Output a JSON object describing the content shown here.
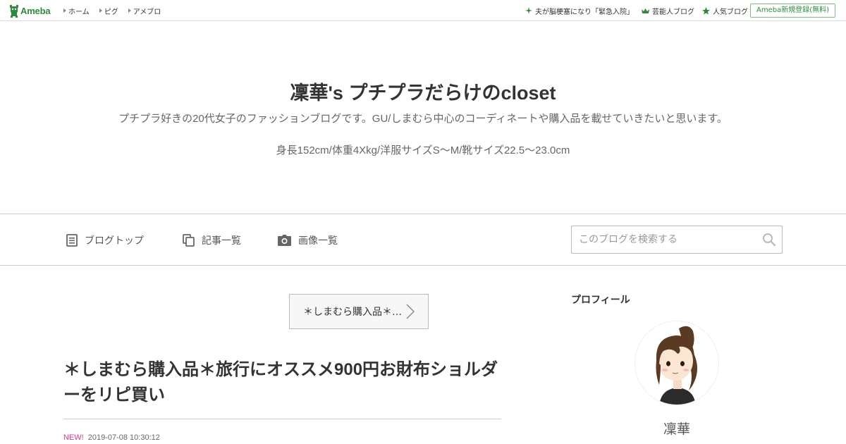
{
  "topbar": {
    "logo_text": "Ameba",
    "nav": [
      {
        "label": "ホーム"
      },
      {
        "label": "ピグ"
      },
      {
        "label": "アメブロ"
      }
    ],
    "links": [
      {
        "label": "夫が脳梗塞になり「緊急入院」",
        "icon": "sparkle-icon"
      },
      {
        "label": "芸能人ブログ",
        "icon": "crown-icon"
      },
      {
        "label": "人気ブログ",
        "icon": "star-icon"
      }
    ],
    "register_label": "Ameba新規登録(無料)"
  },
  "header": {
    "title": "凜華's プチプラだらけのcloset",
    "description": "プチプラ好きの20代女子のファッションブログです。GU/しまむら中心のコーディネートや購入品を載せていきたいと思います。",
    "description2": "身長152cm/体重4Xkg/洋服サイズS〜M/靴サイズ22.5〜23.0cm"
  },
  "navbar": {
    "items": [
      {
        "label": "ブログトップ",
        "icon": "document-icon"
      },
      {
        "label": "記事一覧",
        "icon": "copy-icon"
      },
      {
        "label": "画像一覧",
        "icon": "camera-icon"
      }
    ],
    "search_placeholder": "このブログを検索する"
  },
  "main": {
    "theme_label": "＊しまむら購入品＊…",
    "post_title": "＊しまむら購入品＊旅行にオススメ900円お財布ショルダーをリピ買い",
    "new_badge": "NEW!",
    "post_date": "2019-07-08 10:30:12"
  },
  "sidebar": {
    "profile_heading": "プロフィール",
    "profile_name": "凜華"
  },
  "colors": {
    "brand_green": "#2d8c3c",
    "new_pink": "#e3358b",
    "border": "#cccccc"
  }
}
